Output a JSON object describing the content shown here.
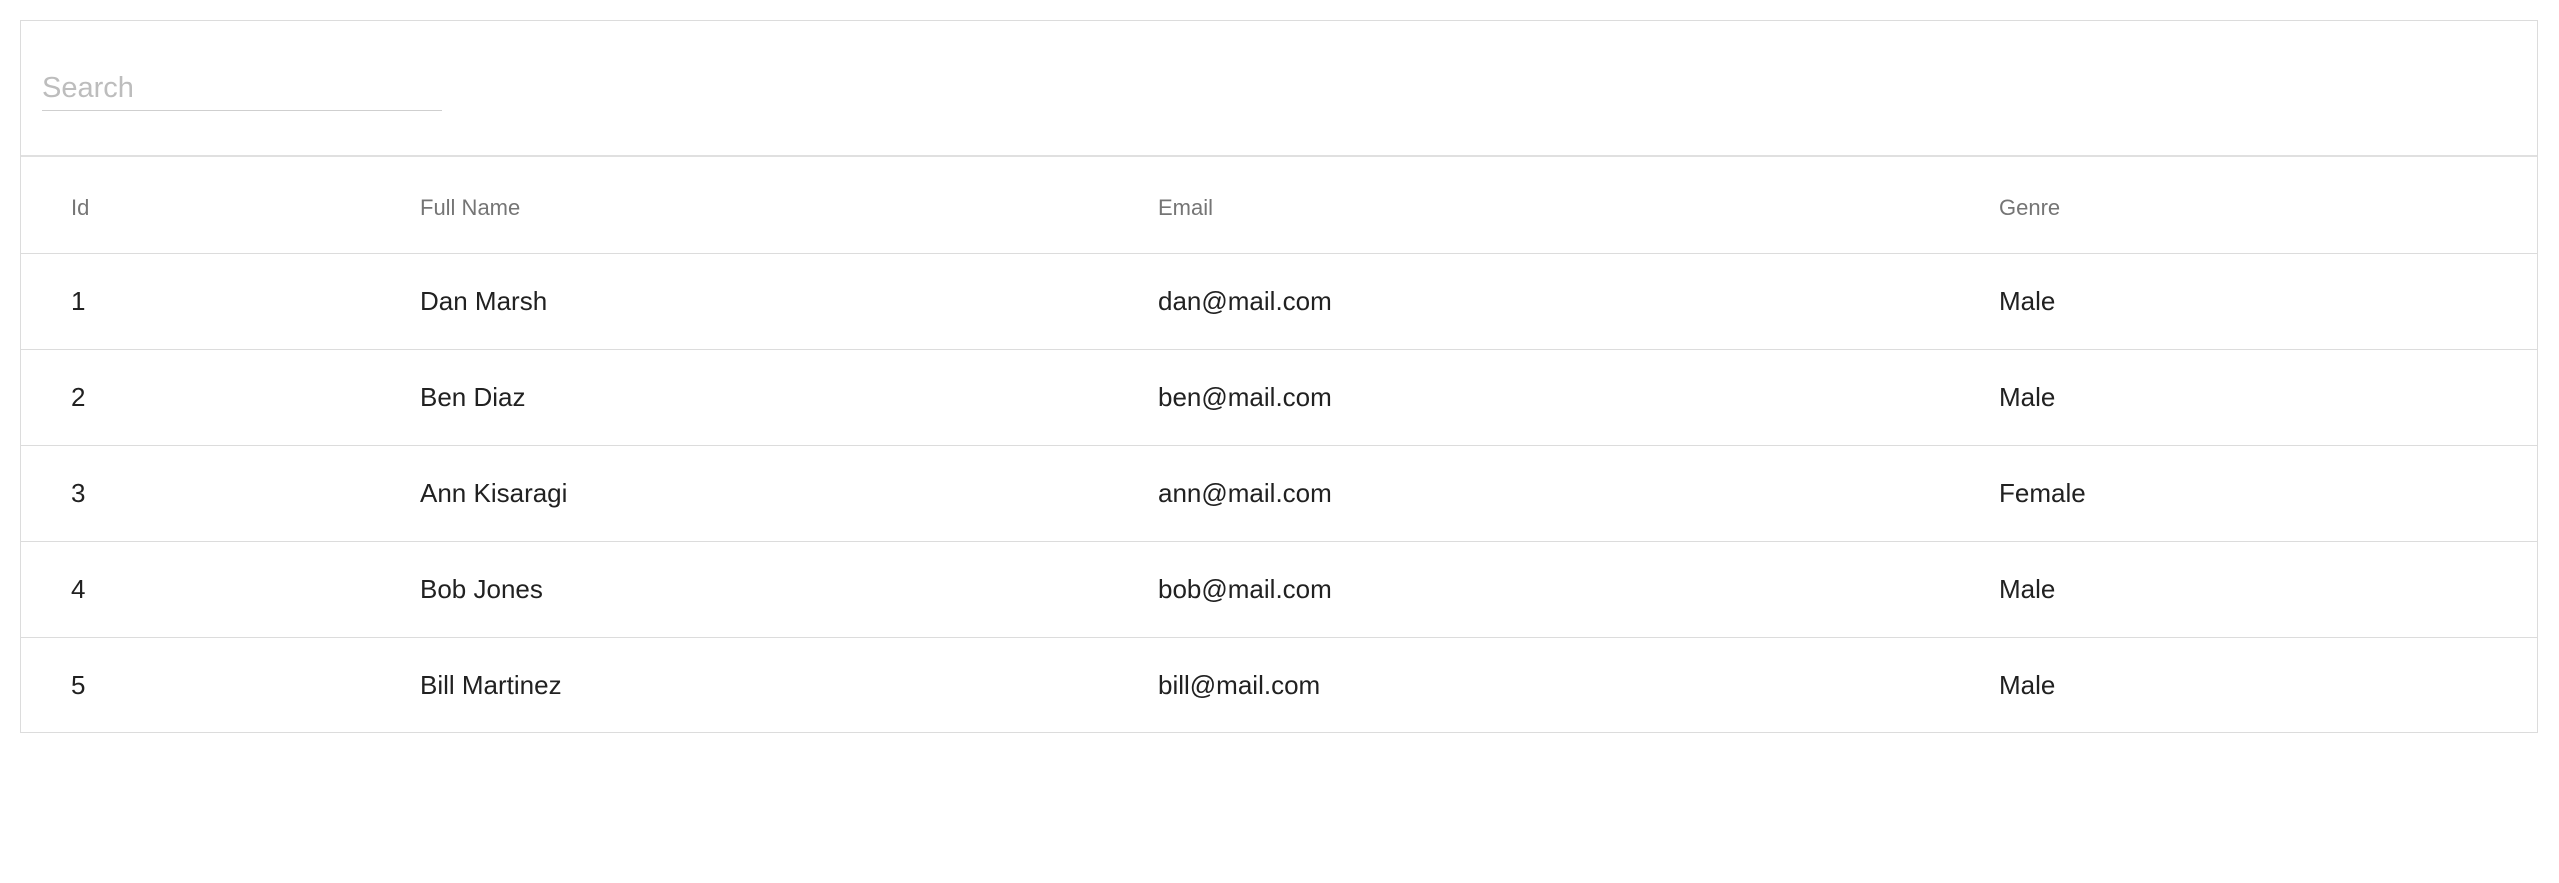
{
  "search": {
    "placeholder": "Search",
    "value": ""
  },
  "table": {
    "columns": [
      "Id",
      "Full Name",
      "Email",
      "Genre"
    ],
    "rows": [
      [
        "1",
        "Dan Marsh",
        "dan@mail.com",
        "Male"
      ],
      [
        "2",
        "Ben Diaz",
        "ben@mail.com",
        "Male"
      ],
      [
        "3",
        "Ann Kisaragi",
        "ann@mail.com",
        "Female"
      ],
      [
        "4",
        "Bob Jones",
        "bob@mail.com",
        "Male"
      ],
      [
        "5",
        "Bill Martinez",
        "bill@mail.com",
        "Male"
      ]
    ]
  }
}
